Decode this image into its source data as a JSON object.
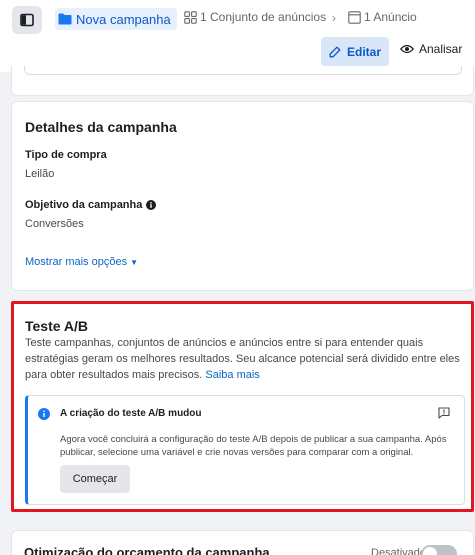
{
  "breadcrumb": {
    "campaign": "Nova campanha",
    "adset": "1 Conjunto de anúncios",
    "ad": "1 Anúncio"
  },
  "actions": {
    "edit": "Editar",
    "review": "Analisar"
  },
  "details": {
    "title": "Detalhes da campanha",
    "buy_type_label": "Tipo de compra",
    "buy_type_value": "Leilão",
    "objective_label": "Objetivo da campanha",
    "objective_value": "Conversões",
    "more_options": "Mostrar mais opções"
  },
  "ab_test": {
    "title": "Teste A/B",
    "description": "Teste campanhas, conjuntos de anúncios e anúncios entre si para entender quais estratégias geram os melhores resultados. Seu alcance potencial será dividido entre eles para obter resultados mais precisos.",
    "learn_more": "Saiba mais",
    "notice_title": "A criação do teste A/B mudou",
    "notice_body": "Agora você concluirá a configuração do teste A/B depois de publicar a sua campanha. Após publicar, selecione uma variável e crie novas versões para comparar com a original.",
    "start_button": "Começar"
  },
  "budget": {
    "title": "Otimização do orçamento da campanha",
    "status": "Desativado",
    "enabled": false
  },
  "colors": {
    "accent": "#1877f2",
    "link": "#0a66c2",
    "highlight_border": "#e0171e"
  }
}
